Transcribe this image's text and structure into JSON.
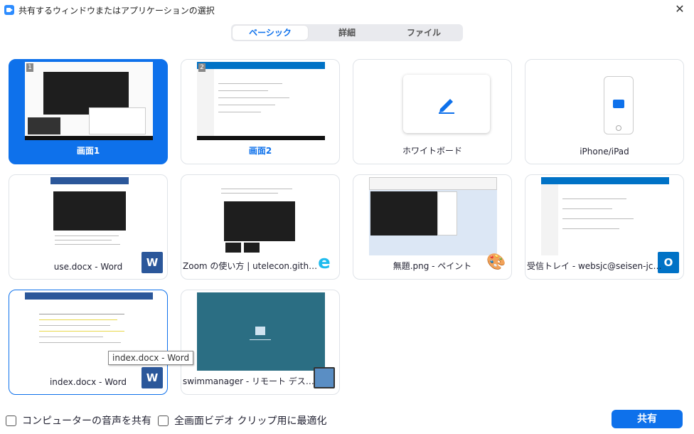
{
  "window": {
    "title": "共有するウィンドウまたはアプリケーションの選択",
    "close_glyph": "✕",
    "app_icon": "zoom-icon"
  },
  "tabs": [
    {
      "label": "ベーシック",
      "active": true
    },
    {
      "label": "詳細",
      "active": false
    },
    {
      "label": "ファイル",
      "active": false
    }
  ],
  "cards": [
    {
      "label": "画面1",
      "badge": "1",
      "state": "selected"
    },
    {
      "label": "画面2",
      "badge": "2",
      "state": "normal"
    },
    {
      "label": "ホワイトボード",
      "icon": "pen-icon"
    },
    {
      "label": "iPhone/iPad",
      "icon": "airplay-icon"
    },
    {
      "label": "use.docx - Word",
      "app": "word-icon",
      "app_glyph": "W"
    },
    {
      "label": "Zoom の使い方 | utelecon.github...",
      "app": "internet-explorer-icon",
      "app_glyph": "e"
    },
    {
      "label": "無題.png - ペイント",
      "app": "paint-icon",
      "app_glyph": "🎨"
    },
    {
      "label": "受信トレイ - websjc@seisen-jc.ac....",
      "app": "outlook-icon",
      "app_glyph": "O"
    },
    {
      "label": "index.docx - Word",
      "app": "word-icon",
      "app_glyph": "W",
      "state": "hover"
    },
    {
      "label": "swimmanager - リモート デスクトッ...",
      "app": "remote-desktop-icon"
    }
  ],
  "tooltip": "index.docx - Word",
  "options": {
    "share_audio": {
      "label": "コンピューターの音声を共有",
      "checked": false
    },
    "optimize_video": {
      "label": "全画面ビデオ クリップ用に最適化",
      "checked": false
    }
  },
  "share_button": "共有",
  "colors": {
    "accent": "#0E71EB",
    "tab_bg": "#E9EAEE",
    "card_border": "#DFE3E8"
  }
}
